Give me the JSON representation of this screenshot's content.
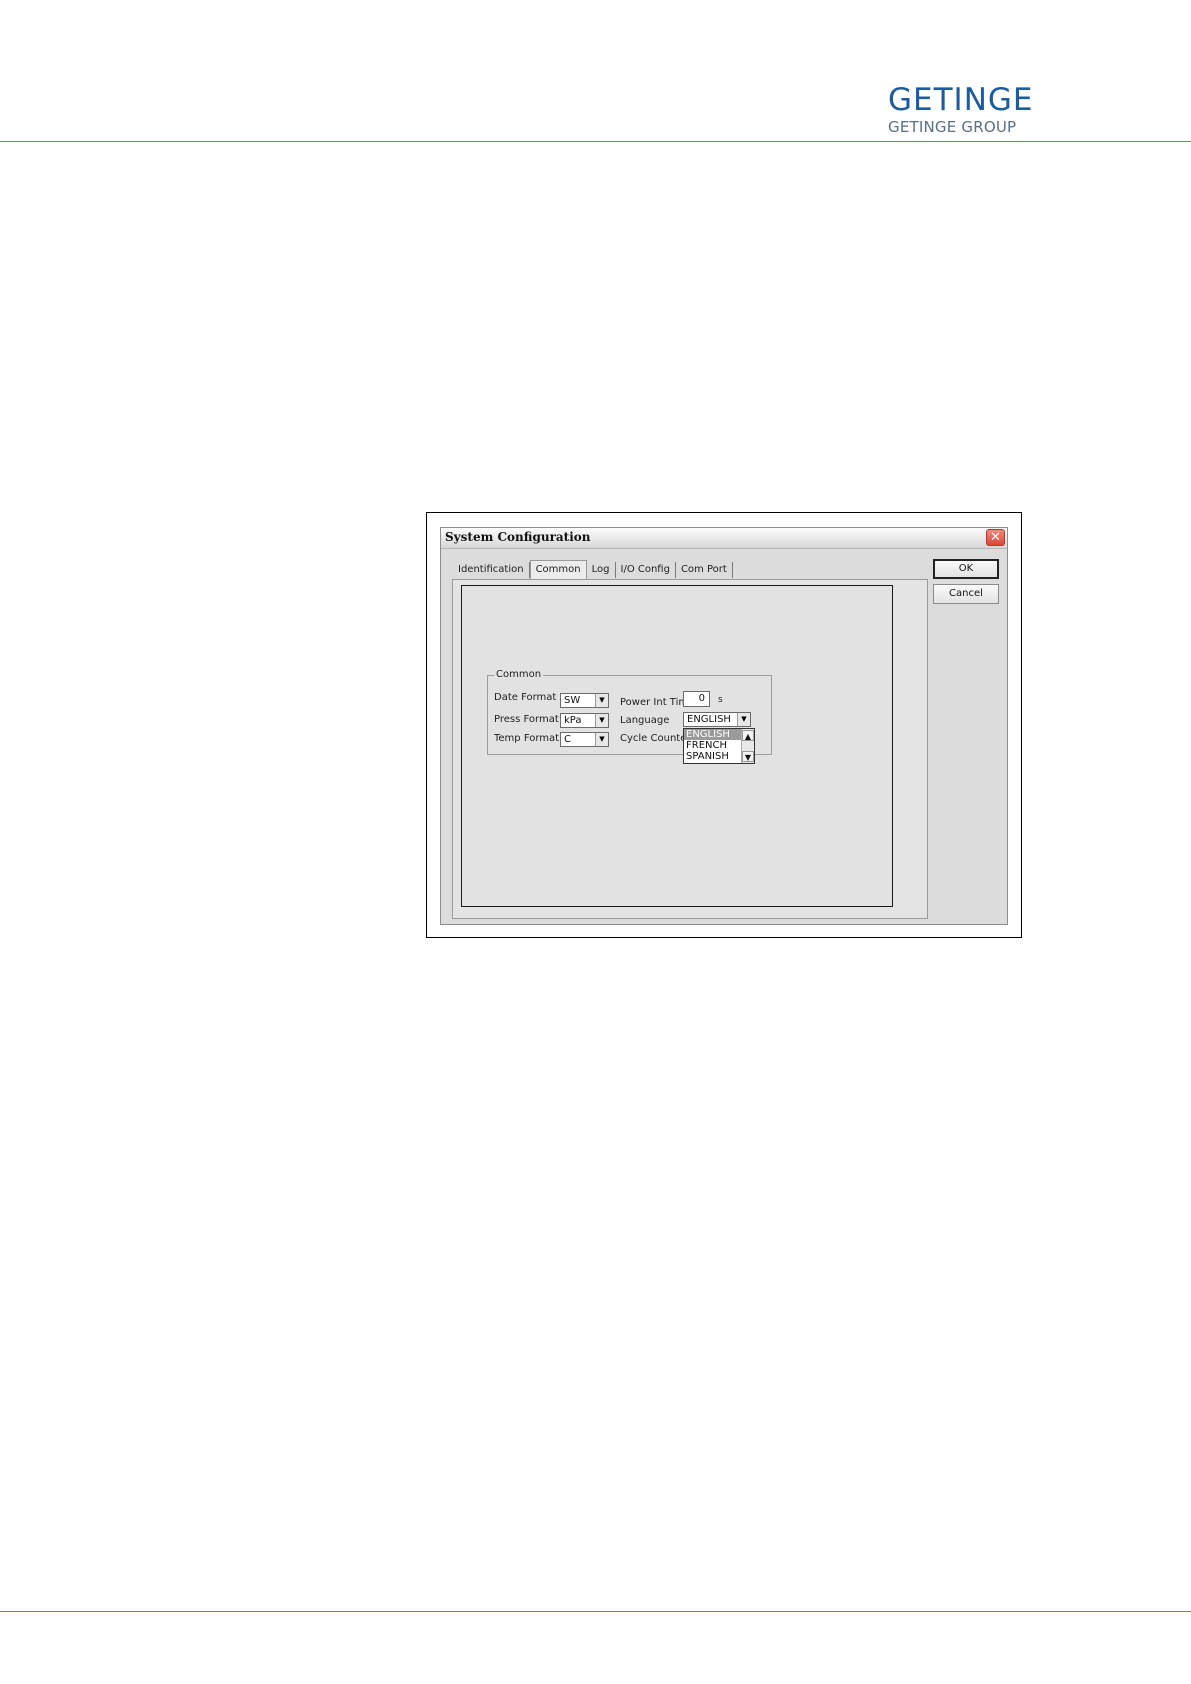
{
  "header": {
    "brand_main": "GETINGE",
    "brand_sub": "GETINGE GROUP"
  },
  "dialog": {
    "title": "System Configuration",
    "close_glyph": "✕",
    "tabs": [
      {
        "label": "Identification",
        "active": false
      },
      {
        "label": "Common",
        "active": true
      },
      {
        "label": "Log",
        "active": false
      },
      {
        "label": "I/O Config",
        "active": false
      },
      {
        "label": "Com Port",
        "active": false
      }
    ],
    "buttons": {
      "ok": "OK",
      "cancel": "Cancel"
    },
    "group": {
      "legend": "Common",
      "date_format_label": "Date Format",
      "date_format_value": "SW",
      "press_format_label": "Press Format",
      "press_format_value": "kPa",
      "temp_format_label": "Temp Format",
      "temp_format_value": "C",
      "power_int_time_label": "Power Int Time",
      "power_int_time_value": "0",
      "power_int_time_unit": "s",
      "language_label": "Language",
      "language_value": "ENGLISH",
      "cycle_counter_label": "Cycle Counter",
      "language_options": [
        "ENGLISH",
        "FRENCH",
        "SPANISH"
      ]
    }
  }
}
